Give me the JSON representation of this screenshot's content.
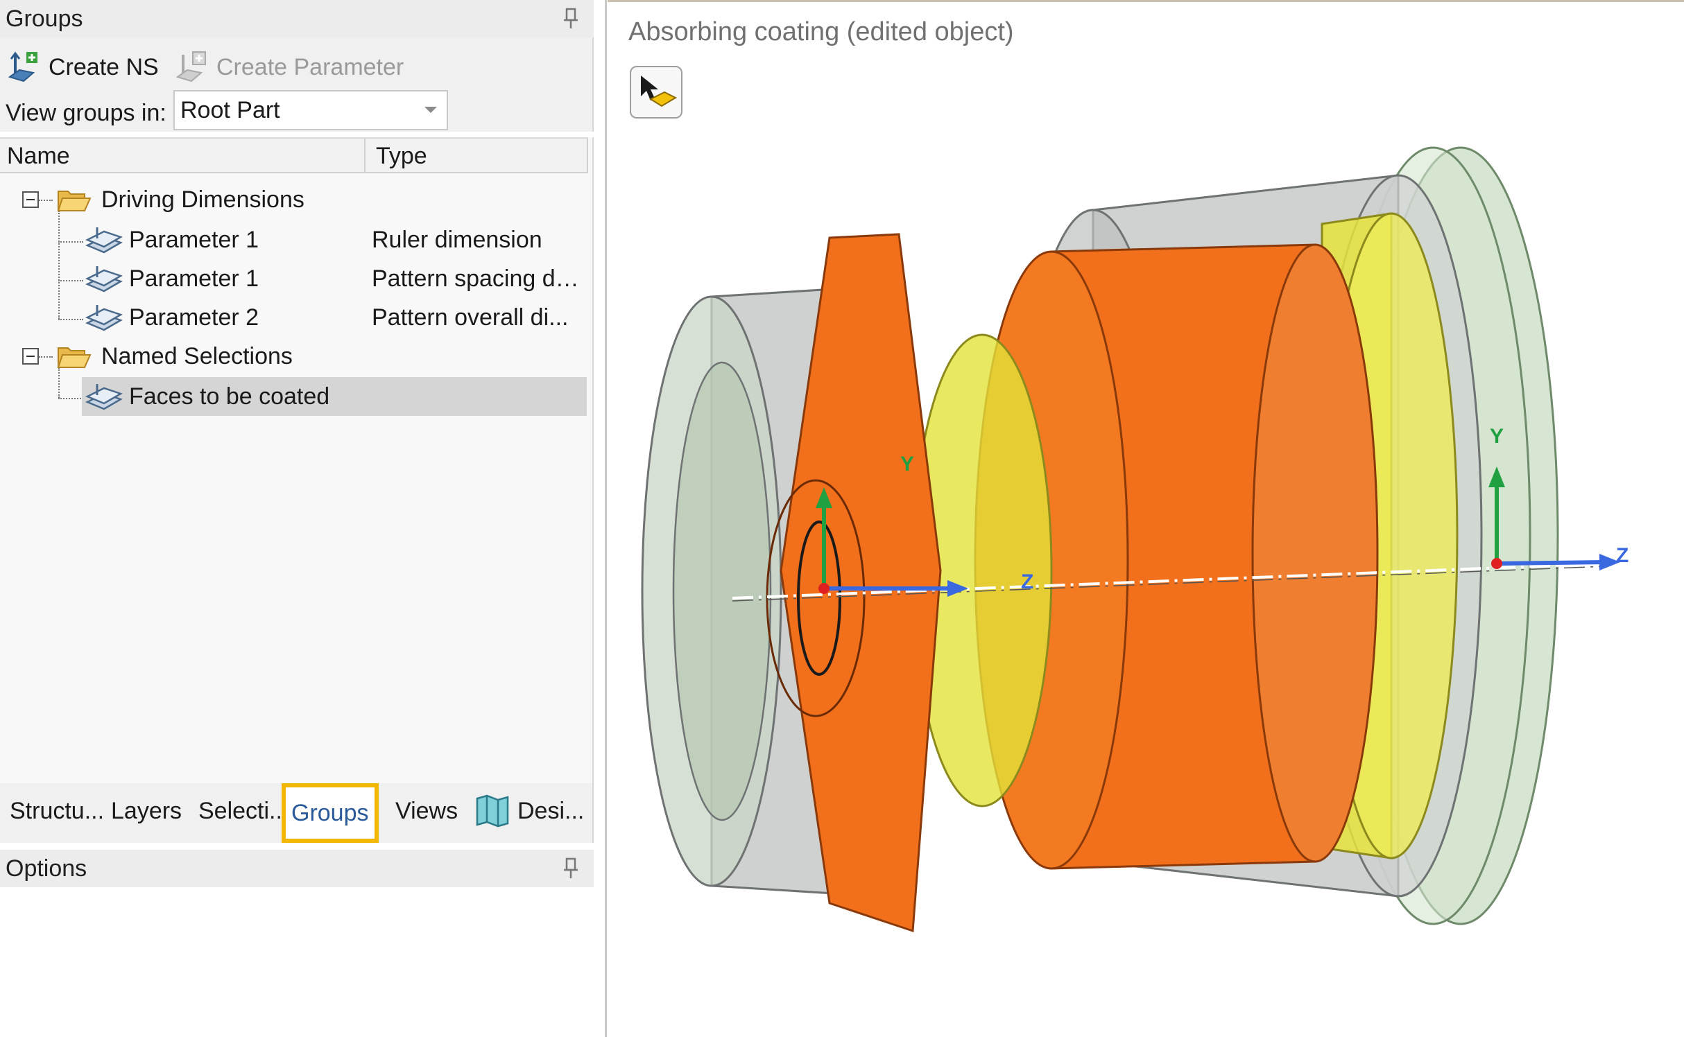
{
  "groups_panel": {
    "title": "Groups",
    "toolbar": {
      "create_ns": "Create NS",
      "create_parameter": "Create Parameter",
      "view_groups_label": "View groups in:",
      "view_groups_value": "Root Part"
    },
    "columns": {
      "name": "Name",
      "type": "Type"
    },
    "tree": {
      "driving": {
        "label": "Driving Dimensions",
        "items": [
          {
            "name": "Parameter 1",
            "type": "Ruler dimension"
          },
          {
            "name": "Parameter 1",
            "type": "Pattern spacing di..."
          },
          {
            "name": "Parameter 2",
            "type": "Pattern overall di..."
          }
        ]
      },
      "named": {
        "label": "Named Selections",
        "items": [
          {
            "name": "Faces to be coated"
          }
        ]
      }
    }
  },
  "tabs": [
    {
      "label": "Structu..."
    },
    {
      "label": "Layers"
    },
    {
      "label": "Selecti..."
    },
    {
      "label": "Groups"
    },
    {
      "label": "Views"
    },
    {
      "label": "Desi..."
    }
  ],
  "options_panel": {
    "title": "Options"
  },
  "viewport": {
    "title": "Absorbing coating (edited object)",
    "axis": {
      "y": "Y",
      "z": "Z"
    }
  },
  "colors": {
    "highlight": "#f2b705",
    "coating_orange": "#f26f1b",
    "yellow_part": "#e0e040",
    "gray_part": "#b9bcbc",
    "green_part": "#b6d0b0",
    "axis_z": "#3a68e0",
    "axis_y": "#20a040",
    "axis_x": "#e02020"
  }
}
